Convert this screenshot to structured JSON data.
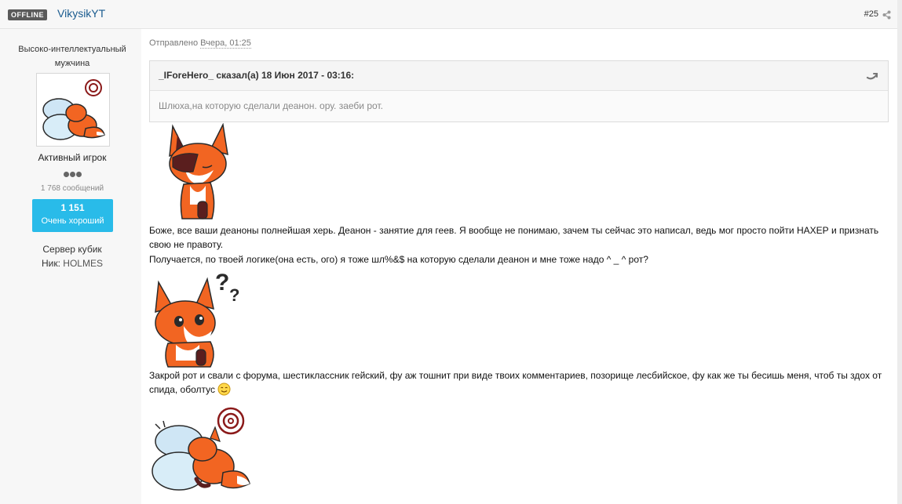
{
  "header": {
    "status": "OFFLINE",
    "author": "VikysikYT",
    "post_number": "#25"
  },
  "sidebar": {
    "member_title": "Высоко-интеллектуальный мужчина",
    "group": "Активный игрок",
    "post_count": "1 768 сообщений",
    "reputation_value": "1 151",
    "reputation_label": "Очень хороший",
    "server_field": "Сервер кубик",
    "nick_label": "Ник:",
    "nick_value": "HOLMES"
  },
  "post": {
    "date_prefix": "Отправлено",
    "date_value": "Вчера, 01:25",
    "quote": {
      "citation": "_IForeHero_ сказал(а) 18 Июн 2017 - 03:16:",
      "text": "Шлюха,на которую сделали деанон. ору. заеби рот."
    },
    "paragraph_1": "Боже, все ваши деаноны полнейшая херь. Деанон - занятие для геев. Я вообще не понимаю, зачем ты сейчас это написал, ведь мог просто пойти НАХЕР и признать свою не правоту.",
    "paragraph_2": "Получается, по твоей логике(она есть, ого) я тоже шл%&$ на которую сделали деанон и мне тоже надо  ^ _ ^ рот?",
    "paragraph_3": "Закрой рот и свали с форума, шестиклассник гейский, фу аж тошнит при виде твоих комментариев, позорище лесбийское, фу как же ты бесишь меня, чтоб ты здох от спида, оболтус"
  },
  "icons": {
    "share": "share-icon",
    "quote_link": "quote-link-icon",
    "smiley": "smiley-icon"
  },
  "colors": {
    "author_link": "#1a5b8f",
    "reputation_bg": "#29bbe9",
    "status_badge": "#5a5a5a",
    "fox_orange": "#f26522"
  }
}
